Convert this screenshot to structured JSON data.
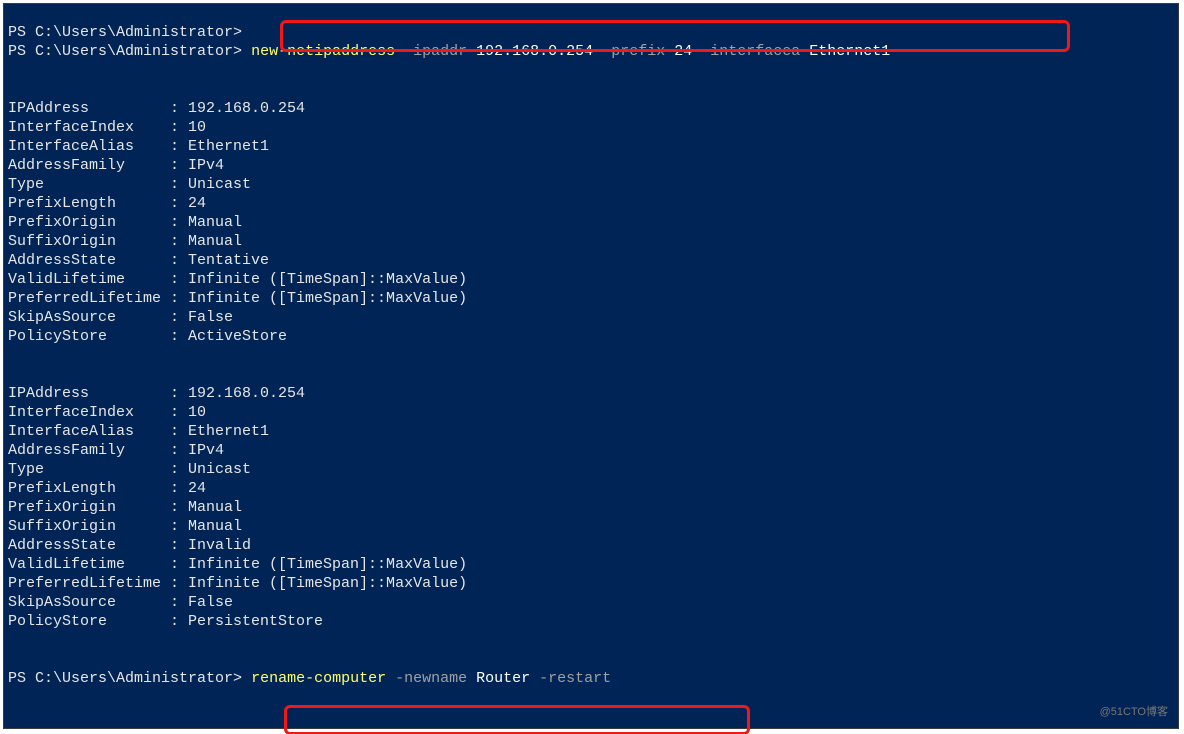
{
  "prompts": {
    "path": "PS C:\\Users\\Administrator>",
    "cmd1": {
      "cmdlet": "new-netipaddress",
      "p_ipaddr": "-ipaddr",
      "v_ipaddr": "192.168.0.254",
      "p_prefix": "-prefix",
      "v_prefix": "24",
      "p_if": "-interfacea",
      "v_if": "Ethernet1"
    },
    "cmd2": {
      "cmdlet": "rename-computer",
      "p_name": "-newname",
      "v_name": "Router",
      "p_restart": "-restart"
    }
  },
  "block1": [
    {
      "k": "IPAddress",
      "v": "192.168.0.254"
    },
    {
      "k": "InterfaceIndex",
      "v": "10"
    },
    {
      "k": "InterfaceAlias",
      "v": "Ethernet1"
    },
    {
      "k": "AddressFamily",
      "v": "IPv4"
    },
    {
      "k": "Type",
      "v": "Unicast"
    },
    {
      "k": "PrefixLength",
      "v": "24"
    },
    {
      "k": "PrefixOrigin",
      "v": "Manual"
    },
    {
      "k": "SuffixOrigin",
      "v": "Manual"
    },
    {
      "k": "AddressState",
      "v": "Tentative"
    },
    {
      "k": "ValidLifetime",
      "v": "Infinite ([TimeSpan]::MaxValue)"
    },
    {
      "k": "PreferredLifetime",
      "v": "Infinite ([TimeSpan]::MaxValue)"
    },
    {
      "k": "SkipAsSource",
      "v": "False"
    },
    {
      "k": "PolicyStore",
      "v": "ActiveStore"
    }
  ],
  "block2": [
    {
      "k": "IPAddress",
      "v": "192.168.0.254"
    },
    {
      "k": "InterfaceIndex",
      "v": "10"
    },
    {
      "k": "InterfaceAlias",
      "v": "Ethernet1"
    },
    {
      "k": "AddressFamily",
      "v": "IPv4"
    },
    {
      "k": "Type",
      "v": "Unicast"
    },
    {
      "k": "PrefixLength",
      "v": "24"
    },
    {
      "k": "PrefixOrigin",
      "v": "Manual"
    },
    {
      "k": "SuffixOrigin",
      "v": "Manual"
    },
    {
      "k": "AddressState",
      "v": "Invalid"
    },
    {
      "k": "ValidLifetime",
      "v": "Infinite ([TimeSpan]::MaxValue)"
    },
    {
      "k": "PreferredLifetime",
      "v": "Infinite ([TimeSpan]::MaxValue)"
    },
    {
      "k": "SkipAsSource",
      "v": "False"
    },
    {
      "k": "PolicyStore",
      "v": "PersistentStore"
    }
  ],
  "watermark": "@51CTO博客"
}
